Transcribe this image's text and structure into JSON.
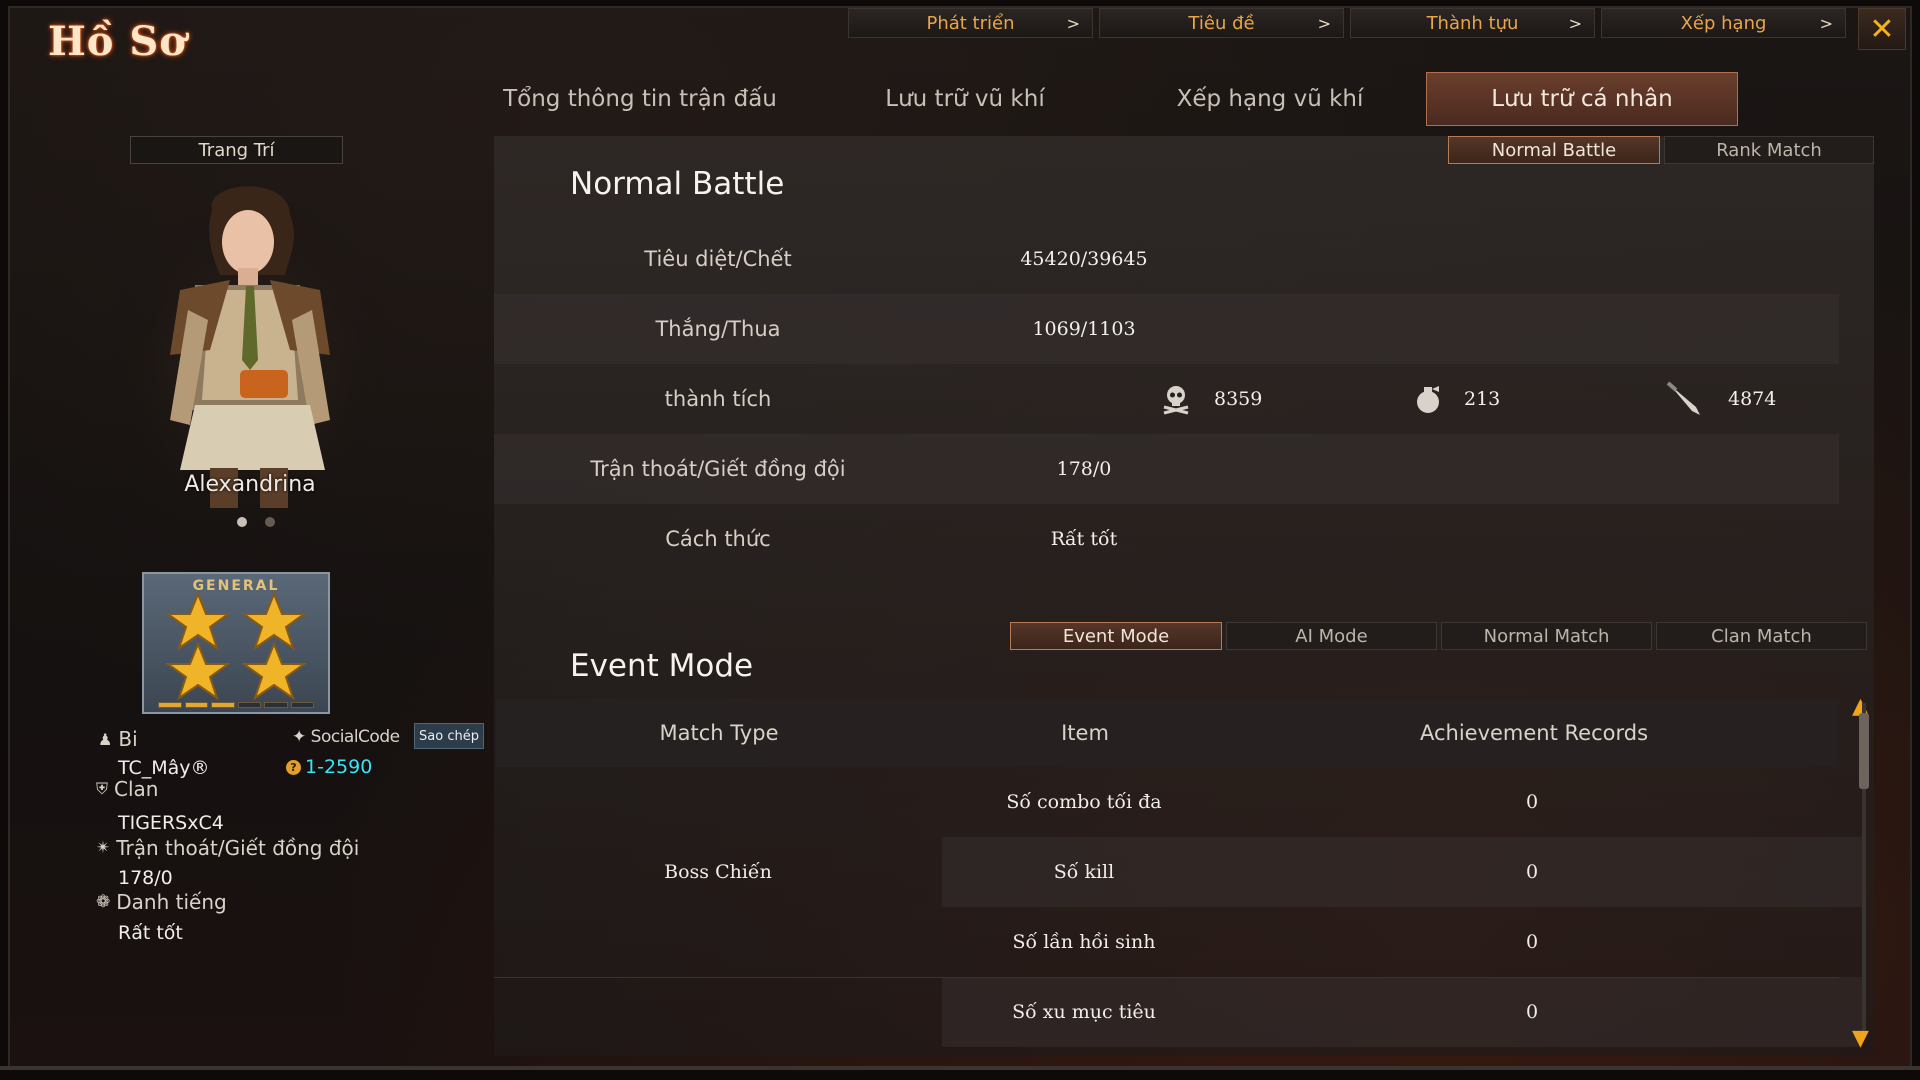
{
  "title": "Hồ Sơ",
  "top_menu": [
    {
      "label": "Phát triển",
      "arrow": ">"
    },
    {
      "label": "Tiêu đề",
      "arrow": ">"
    },
    {
      "label": "Thành tựu",
      "arrow": ">"
    },
    {
      "label": "Xếp hạng",
      "arrow": ">"
    }
  ],
  "close_icon": "✕",
  "main_tabs": [
    {
      "label": "Tổng thông tin trận đấu"
    },
    {
      "label": "Lưu trữ vũ khí"
    },
    {
      "label": "Xếp hạng vũ khí"
    },
    {
      "label": "Lưu trữ cá nhân"
    }
  ],
  "left": {
    "decor_button": "Trang Trí",
    "character_name": "Alexandrina",
    "rank_badge": {
      "title": "GENERAL",
      "stars": 4,
      "progress_filled": 3,
      "progress_total": 6
    },
    "nick_label": "Bi",
    "nick_value": "TC_Mây®",
    "social_label": "SocialCode",
    "copy_button": "Sao chép",
    "social_value": "1-2590",
    "coin_symbol": "?",
    "clan_label": "Clan",
    "clan_value": "TIGERSxC4",
    "escape_label": "Trận thoát/Giết đồng đội",
    "escape_value": "178/0",
    "fame_label": "Danh tiếng",
    "fame_value": "Rất tốt"
  },
  "battle_tabs": [
    {
      "label": "Normal Battle"
    },
    {
      "label": "Rank Match"
    }
  ],
  "normal_battle": {
    "title": "Normal Battle",
    "kd_label": "Tiêu diệt/Chết",
    "kd_value": "45420/39645",
    "wl_label": "Thắng/Thua",
    "wl_value": "1069/1103",
    "ach_label": "thành tích",
    "ach_skull": "8359",
    "ach_grenade": "213",
    "ach_knife": "4874",
    "escape_label": "Trận thoát/Giết đồng đội",
    "escape_value": "178/0",
    "manner_label": "Cách thức",
    "manner_value": "Rất tốt"
  },
  "mode_tabs": [
    {
      "label": "Event Mode"
    },
    {
      "label": "AI Mode"
    },
    {
      "label": "Normal Match"
    },
    {
      "label": "Clan Match"
    }
  ],
  "event_mode": {
    "title": "Event Mode",
    "headers": [
      "Match Type",
      "Item",
      "Achievement Records"
    ],
    "match_type": "Boss Chiến",
    "rows": [
      {
        "item": "Số combo tối đa",
        "value": "0"
      },
      {
        "item": "Số kill",
        "value": "0"
      },
      {
        "item": "Số lần hồi sinh",
        "value": "0"
      },
      {
        "item": "Số xu mục tiêu",
        "value": "0"
      }
    ]
  }
}
